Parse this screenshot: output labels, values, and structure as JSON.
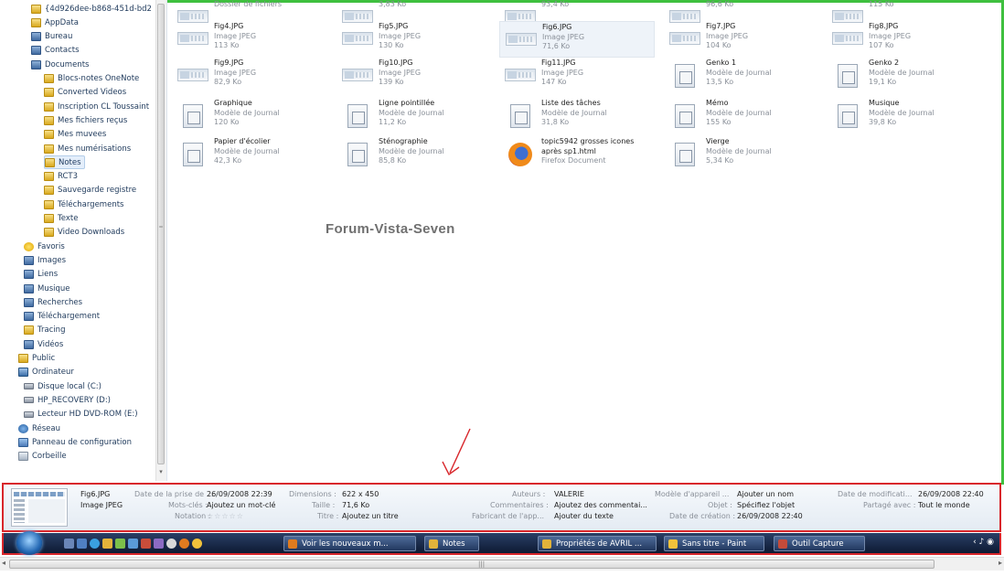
{
  "nav": {
    "items": [
      {
        "label": "{4d926dee-b868-451d-bd2",
        "icon": "folder-icon"
      },
      {
        "label": "AppData",
        "icon": "folder-icon"
      },
      {
        "label": "Bureau",
        "icon": "library-icon"
      },
      {
        "label": "Contacts",
        "icon": "library-icon"
      },
      {
        "label": "Documents",
        "icon": "library-icon"
      },
      {
        "label": "Blocs-notes OneNote",
        "icon": "folder-icon"
      },
      {
        "label": "Converted Videos",
        "icon": "folder-icon"
      },
      {
        "label": "Inscription CL Toussaint",
        "icon": "folder-icon"
      },
      {
        "label": "Mes fichiers reçus",
        "icon": "folder-icon"
      },
      {
        "label": "Mes muvees",
        "icon": "folder-icon"
      },
      {
        "label": "Mes numérisations",
        "icon": "folder-icon"
      },
      {
        "label": "Notes",
        "icon": "folder-icon"
      },
      {
        "label": "RCT3",
        "icon": "folder-icon"
      },
      {
        "label": "Sauvegarde registre",
        "icon": "folder-icon"
      },
      {
        "label": "Téléchargements",
        "icon": "folder-icon"
      },
      {
        "label": "Texte",
        "icon": "folder-icon"
      },
      {
        "label": "Video Downloads",
        "icon": "folder-icon"
      },
      {
        "label": "Favoris",
        "icon": "star-icon"
      },
      {
        "label": "Images",
        "icon": "library-icon"
      },
      {
        "label": "Liens",
        "icon": "library-icon"
      },
      {
        "label": "Musique",
        "icon": "library-icon"
      },
      {
        "label": "Recherches",
        "icon": "library-icon"
      },
      {
        "label": "Téléchargement",
        "icon": "library-icon"
      },
      {
        "label": "Tracing",
        "icon": "folder-icon"
      },
      {
        "label": "Vidéos",
        "icon": "library-icon"
      },
      {
        "label": "Public",
        "icon": "folder-icon"
      },
      {
        "label": "Ordinateur",
        "icon": "computer-icon"
      },
      {
        "label": "Disque local (C:)",
        "icon": "drive-icon"
      },
      {
        "label": "HP_RECOVERY (D:)",
        "icon": "drive-icon"
      },
      {
        "label": "Lecteur HD DVD-ROM (E:)",
        "icon": "drive-icon"
      },
      {
        "label": "Réseau",
        "icon": "network-icon"
      },
      {
        "label": "Panneau de configuration",
        "icon": "control-panel-icon"
      },
      {
        "label": "Corbeille",
        "icon": "recycle-bin-icon"
      }
    ],
    "selected": "Notes"
  },
  "files": [
    {
      "name": "",
      "type": "Dossier de fichiers",
      "size": ""
    },
    {
      "name": "",
      "type": "",
      "size": "3,83 Ko"
    },
    {
      "name": "",
      "type": "",
      "size": "93,4 Ko"
    },
    {
      "name": "",
      "type": "",
      "size": "96,6 Ko"
    },
    {
      "name": "",
      "type": "",
      "size": "115 Ko"
    },
    {
      "name": "Fig4.JPG",
      "type": "Image JPEG",
      "size": "113 Ko"
    },
    {
      "name": "Fig5.JPG",
      "type": "Image JPEG",
      "size": "130 Ko"
    },
    {
      "name": "Fig6.JPG",
      "type": "Image JPEG",
      "size": "71,6 Ko"
    },
    {
      "name": "Fig7.JPG",
      "type": "Image JPEG",
      "size": "104 Ko"
    },
    {
      "name": "Fig8.JPG",
      "type": "Image JPEG",
      "size": "107 Ko"
    },
    {
      "name": "Fig9.JPG",
      "type": "Image JPEG",
      "size": "82,9 Ko"
    },
    {
      "name": "Fig10.JPG",
      "type": "Image JPEG",
      "size": "139 Ko"
    },
    {
      "name": "Fig11.JPG",
      "type": "Image JPEG",
      "size": "147 Ko"
    },
    {
      "name": "Genko 1",
      "type": "Modèle de Journal",
      "size": "13,5 Ko"
    },
    {
      "name": "Genko 2",
      "type": "Modèle de Journal",
      "size": "19,1 Ko"
    },
    {
      "name": "Graphique",
      "type": "Modèle de Journal",
      "size": "120 Ko"
    },
    {
      "name": "Ligne pointillée",
      "type": "Modèle de Journal",
      "size": "11,2 Ko"
    },
    {
      "name": "Liste des tâches",
      "type": "Modèle de Journal",
      "size": "31,8 Ko"
    },
    {
      "name": "Mémo",
      "type": "Modèle de Journal",
      "size": "155 Ko"
    },
    {
      "name": "Musique",
      "type": "Modèle de Journal",
      "size": "39,8 Ko"
    },
    {
      "name": "Papier d'écolier",
      "type": "Modèle de Journal",
      "size": "42,3 Ko"
    },
    {
      "name": "Sténographie",
      "type": "Modèle de Journal",
      "size": "85,8 Ko"
    },
    {
      "name": "topic5942 grosses icones",
      "name2": "après sp1.html",
      "type": "Firefox Document",
      "size": ""
    },
    {
      "name": "Vierge",
      "type": "Modèle de Journal",
      "size": "5,34 Ko"
    }
  ],
  "watermark": "Forum-Vista-Seven",
  "details": {
    "name": "Fig6.JPG",
    "type": "Image JPEG",
    "date_taken_label": "Date de la prise de ...",
    "date_taken": "26/09/2008 22:39",
    "keywords_label": "Mots-clés :",
    "keywords": "Ajoutez un mot-clé",
    "rating_label": "Notation :",
    "rating": "☆☆☆☆☆",
    "dimensions_label": "Dimensions :",
    "dimensions": "622 x 450",
    "size_label": "Taille :",
    "size": "71,6 Ko",
    "title_label": "Titre :",
    "title": "Ajoutez un titre",
    "authors_label": "Auteurs :",
    "authors": "VALERIE",
    "comments_label": "Commentaires :",
    "comments": "Ajoutez des commentai...",
    "maker_label": "Fabricant de l'app...",
    "maker": "Ajouter du texte",
    "model_label": "Modèle d'appareil ...",
    "model": "Ajouter un nom",
    "subject_label": "Objet :",
    "subject": "Spécifiez l'objet",
    "created_label": "Date de création :",
    "created": "26/09/2008 22:40",
    "modified_label": "Date de modificati...",
    "modified": "26/09/2008 22:40",
    "shared_label": "Partagé avec :",
    "shared": "Tout le monde"
  },
  "taskbar": {
    "tasks": [
      {
        "label": "Voir les nouveaux m...",
        "icon": "firefox-icon"
      },
      {
        "label": "Notes",
        "icon": "folder-icon"
      },
      {
        "label": "Propriétés de AVRIL ...",
        "icon": "folder-icon"
      },
      {
        "label": "Sans titre - Paint",
        "icon": "paint-icon"
      },
      {
        "label": "Outil Capture",
        "icon": "snipping-tool-icon"
      }
    ],
    "tray": "‹ ♪ ◉"
  },
  "scrollbar": {
    "grip": "|||",
    "left": "◂",
    "right": "▸"
  }
}
